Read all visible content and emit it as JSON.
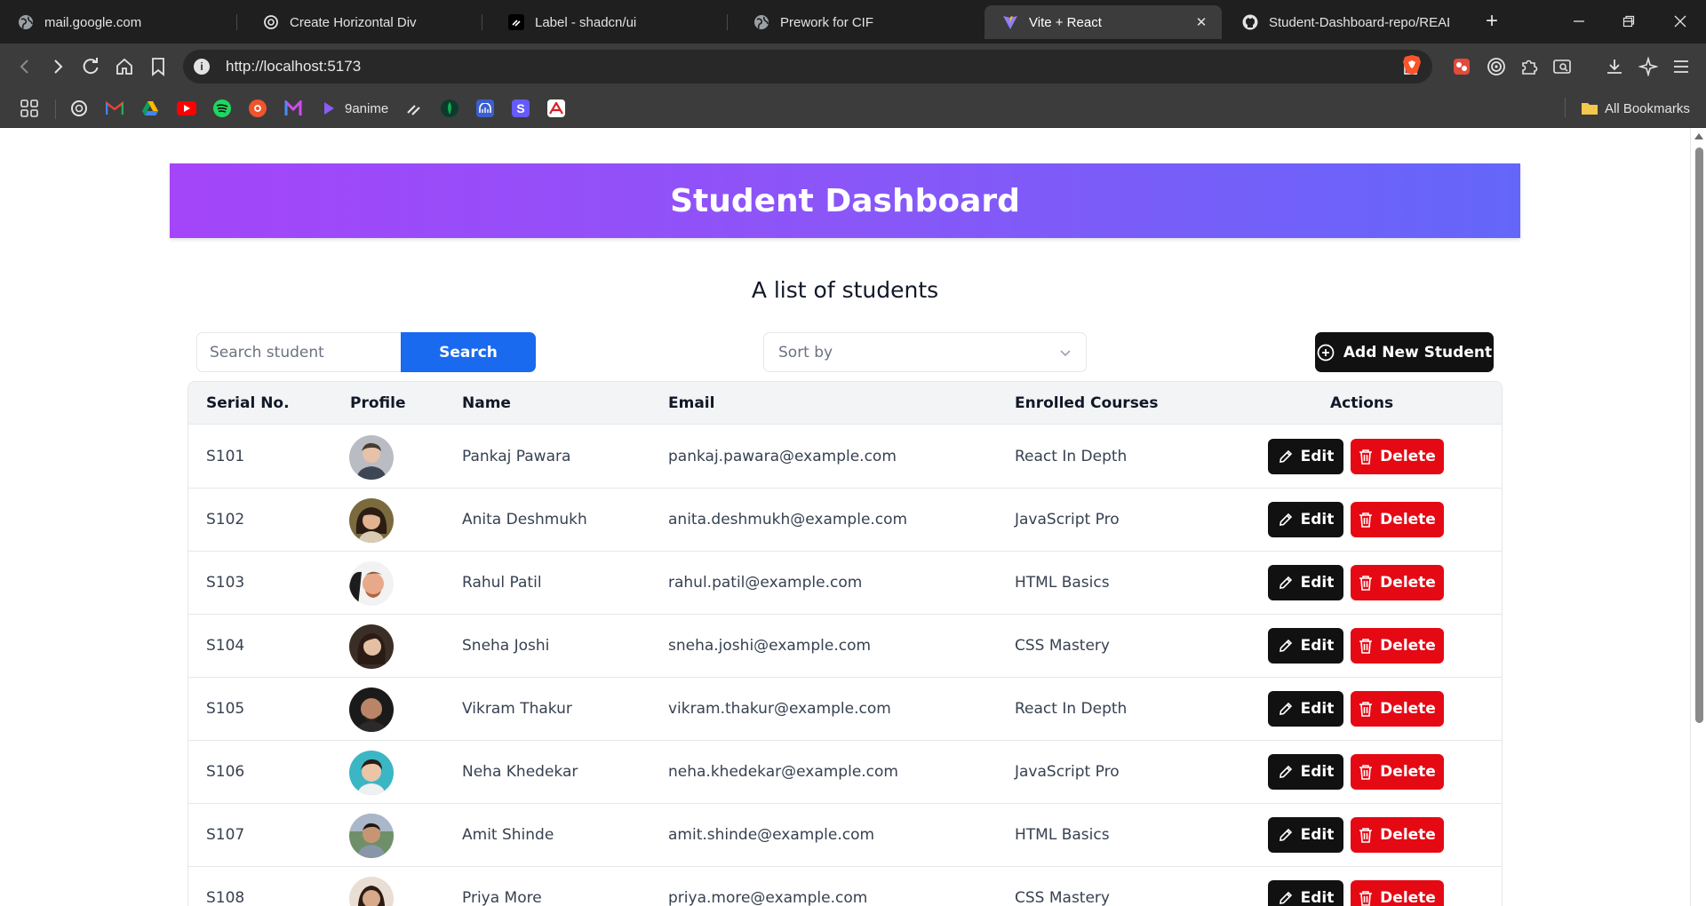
{
  "browser": {
    "tabs": [
      {
        "title": "mail.google.com",
        "icon": "globe-icon",
        "active": false
      },
      {
        "title": "Create Horizontal Div",
        "icon": "openai-icon",
        "active": false
      },
      {
        "title": "Label - shadcn/ui",
        "icon": "shadcn-icon",
        "active": false
      },
      {
        "title": "Prework for CIF",
        "icon": "globe-icon",
        "active": false
      },
      {
        "title": "Vite + React",
        "icon": "vite-icon",
        "active": true
      },
      {
        "title": "Student-Dashboard-repo/READM",
        "icon": "github-icon",
        "active": false
      }
    ],
    "url": "http://localhost:5173",
    "bookmarks": [
      {
        "label": "",
        "icon": "openai-icon"
      },
      {
        "label": "",
        "icon": "gmail-icon"
      },
      {
        "label": "",
        "icon": "drive-icon"
      },
      {
        "label": "",
        "icon": "youtube-icon"
      },
      {
        "label": "",
        "icon": "spotify-icon"
      },
      {
        "label": "",
        "icon": "bookmark-icon-1"
      },
      {
        "label": "",
        "icon": "bookmark-icon-2"
      },
      {
        "label": "9anime",
        "icon": "play-icon"
      },
      {
        "label": "",
        "icon": "shadcn-icon"
      },
      {
        "label": "",
        "icon": "mongodb-icon"
      },
      {
        "label": "",
        "icon": "bookmark-icon-3"
      },
      {
        "label": "",
        "icon": "stripe-icon"
      },
      {
        "label": "",
        "icon": "bookmark-icon-4"
      }
    ],
    "all_bookmarks_label": "All Bookmarks"
  },
  "page": {
    "title": "Student Dashboard",
    "subtitle": "A list of students",
    "search": {
      "placeholder": "Search student",
      "button_label": "Search"
    },
    "sort": {
      "placeholder": "Sort by"
    },
    "add_button_label": "Add New Student",
    "table": {
      "headers": [
        "Serial No.",
        "Profile",
        "Name",
        "Email",
        "Enrolled Courses",
        "Actions"
      ],
      "edit_label": "Edit",
      "delete_label": "Delete",
      "rows": [
        {
          "serial": "S101",
          "name": "Pankaj Pawara",
          "email": "pankaj.pawara@example.com",
          "course": "React In Depth"
        },
        {
          "serial": "S102",
          "name": "Anita Deshmukh",
          "email": "anita.deshmukh@example.com",
          "course": "JavaScript Pro"
        },
        {
          "serial": "S103",
          "name": "Rahul Patil",
          "email": "rahul.patil@example.com",
          "course": "HTML Basics"
        },
        {
          "serial": "S104",
          "name": "Sneha Joshi",
          "email": "sneha.joshi@example.com",
          "course": "CSS Mastery"
        },
        {
          "serial": "S105",
          "name": "Vikram Thakur",
          "email": "vikram.thakur@example.com",
          "course": "React In Depth"
        },
        {
          "serial": "S106",
          "name": "Neha Khedekar",
          "email": "neha.khedekar@example.com",
          "course": "JavaScript Pro"
        },
        {
          "serial": "S107",
          "name": "Amit Shinde",
          "email": "amit.shinde@example.com",
          "course": "HTML Basics"
        },
        {
          "serial": "S108",
          "name": "Priya More",
          "email": "priya.more@example.com",
          "course": "CSS Mastery"
        }
      ]
    }
  },
  "colors": {
    "header_gradient_start": "#a445fa",
    "header_gradient_end": "#6466fa",
    "search_button": "#1a6af0",
    "edit_button": "#111111",
    "delete_button": "#e50914"
  }
}
